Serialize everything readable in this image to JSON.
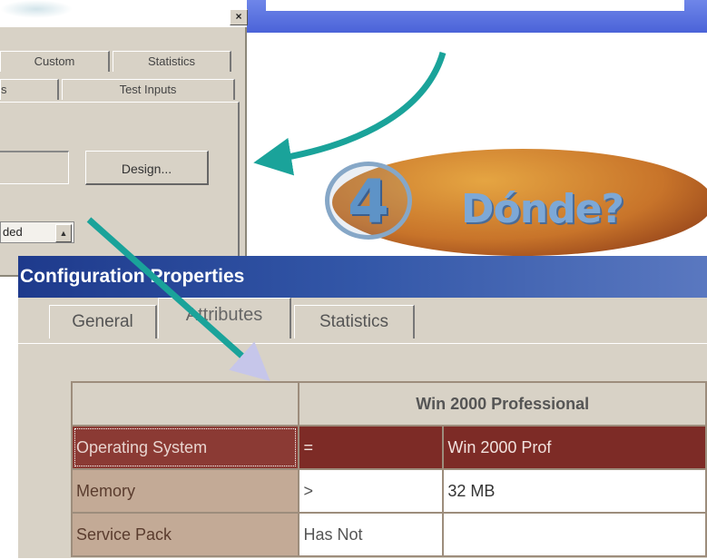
{
  "slide": {
    "step_number": "4",
    "step_title": "Dónde?"
  },
  "test_dialog": {
    "close_glyph": "×",
    "tabs_row1": [
      "Custom",
      "Statistics"
    ],
    "tabs_row2": [
      "s",
      "Test Inputs"
    ],
    "design_label": "Design...",
    "dropdown_value": "ded"
  },
  "config_dialog": {
    "title": "Configuration Properties",
    "tabs": [
      "General",
      "Attributes",
      "Statistics"
    ],
    "active_tab": "Attributes",
    "table": {
      "header": "Win 2000 Professional",
      "rows": [
        {
          "label": "Operating System",
          "op": "=",
          "value": "Win 2000 Prof",
          "selected": true
        },
        {
          "label": "Memory",
          "op": ">",
          "value": "32 MB",
          "selected": false
        },
        {
          "label": "Service Pack",
          "op": "Has Not",
          "value": "",
          "selected": false
        }
      ]
    }
  },
  "colors": {
    "arrow": "#1aa39a",
    "title_bar": "#1e3a8c",
    "selected_row": "#8b3a34",
    "pill": "#c8742a"
  }
}
